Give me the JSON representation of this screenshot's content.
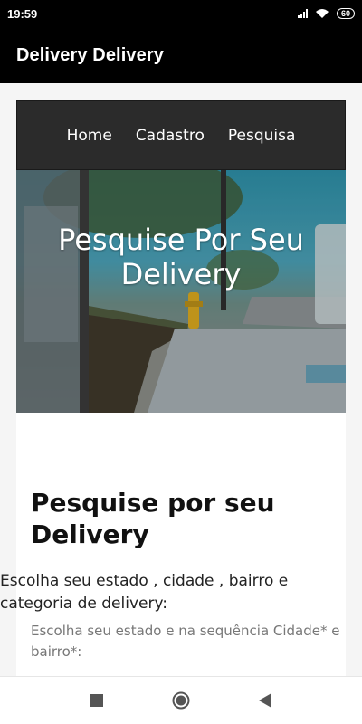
{
  "status_bar": {
    "time": "19:59",
    "battery": "60",
    "icons": [
      "signal-icon",
      "wifi-icon",
      "battery-icon"
    ]
  },
  "app_bar": {
    "title": "Delivery Delivery"
  },
  "site_nav": {
    "items": [
      {
        "label": "Home"
      },
      {
        "label": "Cadastro"
      },
      {
        "label": "Pesquisa"
      }
    ]
  },
  "hero": {
    "title": "Pesquise Por Seu Delivery"
  },
  "search_section": {
    "title": "Pesquise por seu Delivery",
    "description": "Escolha seu estado , cidade , bairro e categoria de delivery:",
    "hint": "Escolha seu estado e na sequência Cidade* e bairro*:"
  },
  "system_nav": {
    "icons": [
      "recent-apps-icon",
      "home-icon",
      "back-icon"
    ]
  },
  "colors": {
    "app_bar": "#000000",
    "site_nav": "#2b2b2b",
    "hint_text": "#777777"
  }
}
